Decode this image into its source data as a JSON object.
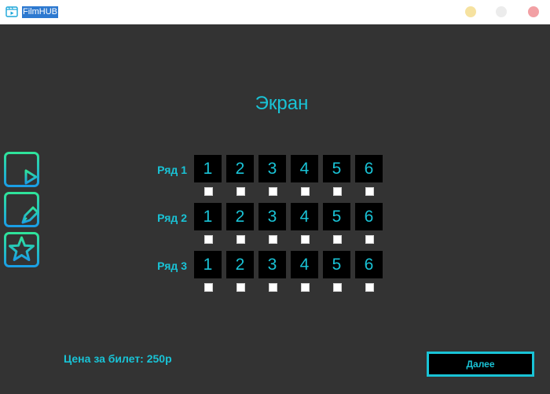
{
  "window": {
    "title": "FilmHUB"
  },
  "screen_label": "Экран",
  "side_nav": [
    {
      "icon": "film-play-icon"
    },
    {
      "icon": "film-edit-icon"
    },
    {
      "icon": "star-icon"
    }
  ],
  "seating": {
    "rows": [
      {
        "label": "Ряд 1",
        "seats": [
          "1",
          "2",
          "3",
          "4",
          "5",
          "6"
        ],
        "checked": [
          false,
          false,
          false,
          false,
          false,
          false
        ]
      },
      {
        "label": "Ряд 2",
        "seats": [
          "1",
          "2",
          "3",
          "4",
          "5",
          "6"
        ],
        "checked": [
          false,
          false,
          false,
          false,
          false,
          false
        ]
      },
      {
        "label": "Ряд 3",
        "seats": [
          "1",
          "2",
          "3",
          "4",
          "5",
          "6"
        ],
        "checked": [
          false,
          false,
          false,
          false,
          false,
          false
        ]
      }
    ]
  },
  "footer": {
    "price": "Цена за билет: 250р",
    "next_label": "Далее"
  },
  "colors": {
    "accent": "#19c3d6",
    "background": "#333333",
    "seat_bg": "#000000"
  }
}
